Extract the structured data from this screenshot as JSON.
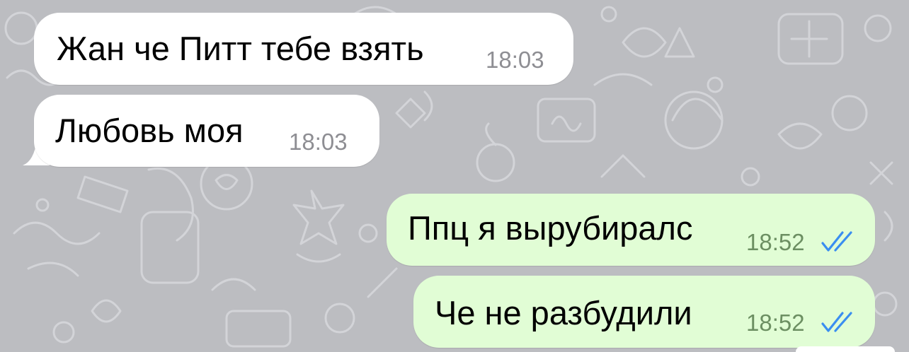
{
  "colors": {
    "wallpaper": "#bcbdc1",
    "wallpaper_doodle": "#d2d3d7",
    "incoming_bubble": "#ffffff",
    "outgoing_bubble": "#e1fdd5",
    "timestamp_incoming": "#8e8e93",
    "timestamp_outgoing": "#6c8f62",
    "read_ticks": "#3a8ef0"
  },
  "messages": [
    {
      "direction": "incoming",
      "text": "Жан че Питт тебе взять",
      "time": "18:03"
    },
    {
      "direction": "incoming",
      "text": "Любовь моя",
      "time": "18:03"
    },
    {
      "direction": "outgoing",
      "text": "Ппц я вырубиралс",
      "time": "18:52",
      "status_icon": "double-check-read-icon"
    },
    {
      "direction": "outgoing",
      "text": "Че не разбудили",
      "time": "18:52",
      "status_icon": "double-check-read-icon"
    }
  ]
}
